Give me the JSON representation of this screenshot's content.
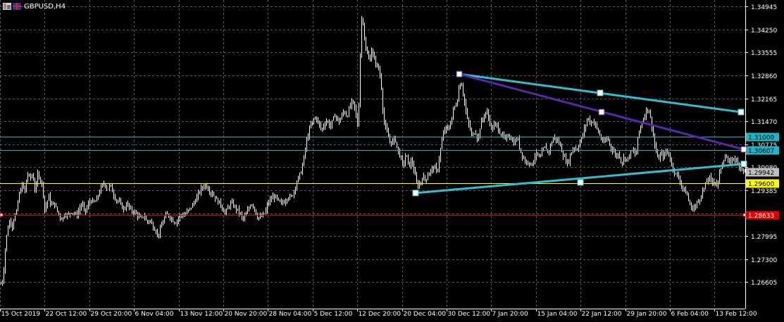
{
  "window": {
    "title": "GBPUSD,H4"
  },
  "colors": {
    "background": "#000000",
    "grid": "#5a5a5a",
    "axis_text": "#ffffff",
    "candle": "#ffffff",
    "trend_cyan": "#2fc0d0",
    "trend_purple": "#5a28a8",
    "hline_cyan": "#20b5c5",
    "hline_yellow": "#ffff00",
    "hline_red": "#e00000",
    "current_price_label": "#c0c0c0"
  },
  "chart_data": {
    "type": "candlestick",
    "symbol": "GBPUSD",
    "timeframe": "H4",
    "ylim": [
      1.258,
      1.351
    ],
    "y_ticks": [
      "1.34945",
      "1.34250",
      "1.33555",
      "1.32860",
      "1.32165",
      "1.31470",
      "1.30775",
      "1.30080",
      "1.29385",
      "1.28690",
      "1.27995",
      "1.27300",
      "1.26605"
    ],
    "x_ticks": [
      "15 Oct 2019",
      "22 Oct 12:00",
      "29 Oct 20:00",
      "6 Nov 04:00",
      "13 Nov 12:00",
      "20 Nov 20:00",
      "28 Nov 04:00",
      "5 Dec 12:00",
      "12 Dec 20:00",
      "20 Dec 04:00",
      "30 Dec 12:00",
      "7 Jan 20:00",
      "15 Jan 04:00",
      "22 Jan 12:00",
      "29 Jan 20:00",
      "6 Feb 04:00",
      "13 Feb 12:00"
    ],
    "close_path": [
      [
        0,
        1.265
      ],
      [
        4,
        1.267
      ],
      [
        7,
        1.276
      ],
      [
        10,
        1.282
      ],
      [
        14,
        1.285
      ],
      [
        17,
        1.283
      ],
      [
        20,
        1.286
      ],
      [
        23,
        1.287
      ],
      [
        26,
        1.292
      ],
      [
        29,
        1.294
      ],
      [
        32,
        1.296
      ],
      [
        35,
        1.293
      ],
      [
        38,
        1.299
      ],
      [
        42,
        1.2975
      ],
      [
        46,
        1.2985
      ],
      [
        50,
        1.293
      ],
      [
        53,
        1.299
      ],
      [
        57,
        1.297
      ],
      [
        60,
        1.295
      ],
      [
        63,
        1.288
      ],
      [
        66,
        1.29
      ],
      [
        69,
        1.292
      ],
      [
        72,
        1.289
      ],
      [
        76,
        1.29
      ],
      [
        80,
        1.288
      ],
      [
        84,
        1.286
      ],
      [
        88,
        1.285
      ],
      [
        92,
        1.287
      ],
      [
        96,
        1.286
      ],
      [
        100,
        1.2875
      ],
      [
        104,
        1.287
      ],
      [
        108,
        1.286
      ],
      [
        112,
        1.288
      ],
      [
        116,
        1.29
      ],
      [
        120,
        1.287
      ],
      [
        124,
        1.289
      ],
      [
        128,
        1.291
      ],
      [
        132,
        1.29
      ],
      [
        136,
        1.2905
      ],
      [
        140,
        1.293
      ],
      [
        144,
        1.295
      ],
      [
        148,
        1.296
      ],
      [
        152,
        1.294
      ],
      [
        156,
        1.2955
      ],
      [
        160,
        1.293
      ],
      [
        164,
        1.291
      ],
      [
        168,
        1.2905
      ],
      [
        172,
        1.289
      ],
      [
        176,
        1.288
      ],
      [
        180,
        1.29
      ],
      [
        184,
        1.288
      ],
      [
        188,
        1.2875
      ],
      [
        192,
        1.287
      ],
      [
        196,
        1.286
      ],
      [
        200,
        1.285
      ],
      [
        204,
        1.2865
      ],
      [
        208,
        1.284
      ],
      [
        212,
        1.285
      ],
      [
        216,
        1.283
      ],
      [
        220,
        1.282
      ],
      [
        224,
        1.28
      ],
      [
        228,
        1.2825
      ],
      [
        232,
        1.285
      ],
      [
        236,
        1.2865
      ],
      [
        240,
        1.286
      ],
      [
        244,
        1.285
      ],
      [
        248,
        1.284
      ],
      [
        252,
        1.285
      ],
      [
        256,
        1.2865
      ],
      [
        260,
        1.286
      ],
      [
        264,
        1.287
      ],
      [
        268,
        1.288
      ],
      [
        272,
        1.289
      ],
      [
        276,
        1.2905
      ],
      [
        280,
        1.292
      ],
      [
        284,
        1.294
      ],
      [
        288,
        1.295
      ],
      [
        292,
        1.2955
      ],
      [
        296,
        1.294
      ],
      [
        300,
        1.293
      ],
      [
        304,
        1.292
      ],
      [
        308,
        1.2905
      ],
      [
        312,
        1.29
      ],
      [
        316,
        1.288
      ],
      [
        320,
        1.287
      ],
      [
        324,
        1.289
      ],
      [
        328,
        1.29
      ],
      [
        332,
        1.289
      ],
      [
        336,
        1.288
      ],
      [
        340,
        1.287
      ],
      [
        344,
        1.285
      ],
      [
        348,
        1.286
      ],
      [
        352,
        1.288
      ],
      [
        356,
        1.29
      ],
      [
        360,
        1.289
      ],
      [
        364,
        1.286
      ],
      [
        368,
        1.2855
      ],
      [
        372,
        1.286
      ],
      [
        376,
        1.287
      ],
      [
        380,
        1.29
      ],
      [
        384,
        1.291
      ],
      [
        388,
        1.292
      ],
      [
        392,
        1.2915
      ],
      [
        396,
        1.29
      ],
      [
        400,
        1.29
      ],
      [
        404,
        1.2905
      ],
      [
        408,
        1.292
      ],
      [
        412,
        1.2915
      ],
      [
        416,
        1.293
      ],
      [
        420,
        1.296
      ],
      [
        424,
        1.298
      ],
      [
        428,
        1.3
      ],
      [
        432,
        1.305
      ],
      [
        436,
        1.31
      ],
      [
        440,
        1.313
      ],
      [
        444,
        1.315
      ],
      [
        448,
        1.316
      ],
      [
        452,
        1.314
      ],
      [
        456,
        1.312
      ],
      [
        460,
        1.314
      ],
      [
        464,
        1.315
      ],
      [
        468,
        1.313
      ],
      [
        472,
        1.315
      ],
      [
        476,
        1.317
      ],
      [
        480,
        1.314
      ],
      [
        484,
        1.316
      ],
      [
        488,
        1.318
      ],
      [
        492,
        1.316
      ],
      [
        496,
        1.319
      ],
      [
        500,
        1.321
      ],
      [
        504,
        1.318
      ],
      [
        508,
        1.312
      ],
      [
        512,
        1.343
      ],
      [
        514,
        1.348
      ],
      [
        516,
        1.342
      ],
      [
        518,
        1.338
      ],
      [
        520,
        1.334
      ],
      [
        522,
        1.336
      ],
      [
        524,
        1.332
      ],
      [
        526,
        1.335
      ],
      [
        528,
        1.338
      ],
      [
        530,
        1.332
      ],
      [
        532,
        1.334
      ],
      [
        534,
        1.331
      ],
      [
        536,
        1.332
      ],
      [
        538,
        1.329
      ],
      [
        540,
        1.328
      ],
      [
        542,
        1.322
      ],
      [
        544,
        1.315
      ],
      [
        548,
        1.312
      ],
      [
        552,
        1.309
      ],
      [
        556,
        1.308
      ],
      [
        560,
        1.31
      ],
      [
        564,
        1.306
      ],
      [
        568,
        1.304
      ],
      [
        572,
        1.301
      ],
      [
        576,
        1.305
      ],
      [
        580,
        1.301
      ],
      [
        584,
        1.303
      ],
      [
        588,
        1.299
      ],
      [
        592,
        1.295
      ],
      [
        596,
        1.296
      ],
      [
        600,
        1.298
      ],
      [
        604,
        1.297
      ],
      [
        608,
        1.299
      ],
      [
        612,
        1.3
      ],
      [
        616,
        1.301
      ],
      [
        620,
        1.299
      ],
      [
        624,
        1.305
      ],
      [
        628,
        1.31
      ],
      [
        632,
        1.313
      ],
      [
        636,
        1.312
      ],
      [
        640,
        1.315
      ],
      [
        644,
        1.319
      ],
      [
        648,
        1.32
      ],
      [
        652,
        1.326
      ],
      [
        654,
        1.327
      ],
      [
        658,
        1.322
      ],
      [
        662,
        1.316
      ],
      [
        666,
        1.313
      ],
      [
        670,
        1.31
      ],
      [
        674,
        1.312
      ],
      [
        678,
        1.309
      ],
      [
        682,
        1.314
      ],
      [
        686,
        1.316
      ],
      [
        690,
        1.318
      ],
      [
        694,
        1.315
      ],
      [
        698,
        1.312
      ],
      [
        702,
        1.314
      ],
      [
        706,
        1.313
      ],
      [
        710,
        1.311
      ],
      [
        714,
        1.31
      ],
      [
        718,
        1.309
      ],
      [
        722,
        1.311
      ],
      [
        726,
        1.309
      ],
      [
        730,
        1.308
      ],
      [
        734,
        1.31
      ],
      [
        738,
        1.306
      ],
      [
        742,
        1.304
      ],
      [
        746,
        1.302
      ],
      [
        750,
        1.303
      ],
      [
        754,
        1.301
      ],
      [
        758,
        1.304
      ],
      [
        762,
        1.305
      ],
      [
        766,
        1.303
      ],
      [
        770,
        1.306
      ],
      [
        774,
        1.307
      ],
      [
        778,
        1.305
      ],
      [
        782,
        1.308
      ],
      [
        786,
        1.31
      ],
      [
        790,
        1.309
      ],
      [
        794,
        1.308
      ],
      [
        798,
        1.305
      ],
      [
        802,
        1.303
      ],
      [
        806,
        1.302
      ],
      [
        810,
        1.305
      ],
      [
        814,
        1.307
      ],
      [
        818,
        1.306
      ],
      [
        822,
        1.308
      ],
      [
        826,
        1.31
      ],
      [
        830,
        1.313
      ],
      [
        834,
        1.316
      ],
      [
        838,
        1.314
      ],
      [
        842,
        1.315
      ],
      [
        846,
        1.313
      ],
      [
        850,
        1.311
      ],
      [
        854,
        1.309
      ],
      [
        858,
        1.308
      ],
      [
        862,
        1.31
      ],
      [
        866,
        1.307
      ],
      [
        870,
        1.306
      ],
      [
        874,
        1.304
      ],
      [
        878,
        1.305
      ],
      [
        882,
        1.302
      ],
      [
        886,
        1.304
      ],
      [
        890,
        1.303
      ],
      [
        894,
        1.305
      ],
      [
        898,
        1.306
      ],
      [
        902,
        1.304
      ],
      [
        906,
        1.311
      ],
      [
        910,
        1.314
      ],
      [
        914,
        1.316
      ],
      [
        918,
        1.319
      ],
      [
        922,
        1.317
      ],
      [
        926,
        1.312
      ],
      [
        930,
        1.306
      ],
      [
        934,
        1.303
      ],
      [
        938,
        1.305
      ],
      [
        942,
        1.304
      ],
      [
        946,
        1.306
      ],
      [
        950,
        1.304
      ],
      [
        954,
        1.301
      ],
      [
        958,
        1.299
      ],
      [
        962,
        1.298
      ],
      [
        966,
        1.296
      ],
      [
        970,
        1.294
      ],
      [
        974,
        1.293
      ],
      [
        978,
        1.29
      ],
      [
        982,
        1.288
      ],
      [
        986,
        1.289
      ],
      [
        990,
        1.29
      ],
      [
        994,
        1.292
      ],
      [
        998,
        1.294
      ],
      [
        1002,
        1.296
      ],
      [
        1006,
        1.298
      ],
      [
        1010,
        1.296
      ],
      [
        1014,
        1.297
      ],
      [
        1018,
        1.295
      ],
      [
        1022,
        1.3
      ],
      [
        1026,
        1.303
      ],
      [
        1030,
        1.304
      ],
      [
        1034,
        1.302
      ],
      [
        1038,
        1.303
      ],
      [
        1042,
        1.304
      ],
      [
        1046,
        1.302
      ],
      [
        1050,
        1.301
      ],
      [
        1054,
        1.3
      ],
      [
        1058,
        1.2994
      ]
    ],
    "horizontal_lines": [
      {
        "price": 1.31,
        "label": "1.31000",
        "color": "#20b5c5"
      },
      {
        "price": 1.30607,
        "label": "1.30607",
        "color": "#20b5c5"
      },
      {
        "price": 1.296,
        "label": "1.29600",
        "color": "#ffff00"
      },
      {
        "price": 1.28633,
        "label": "1.28633",
        "color": "#e00000"
      }
    ],
    "current_price": {
      "price": 1.29942,
      "label": "1.29942"
    },
    "trendlines": [
      {
        "color": "#2fc0d0",
        "from": [
          652,
          1.329
        ],
        "to": [
          1052,
          1.3175
        ],
        "handles": [
          [
            652,
            1.329
          ],
          [
            852,
            1.3233
          ],
          [
            1052,
            1.3175
          ]
        ]
      },
      {
        "color": "#5a28a8",
        "from": [
          652,
          1.329
        ],
        "to": [
          1056,
          1.3062
        ],
        "handles": [
          [
            652,
            1.329
          ],
          [
            854,
            1.3175
          ],
          [
            1056,
            1.3062
          ]
        ]
      },
      {
        "color": "#2fc0d0",
        "from": [
          590,
          1.293
        ],
        "to": [
          1056,
          1.3018
        ],
        "handles": [
          [
            590,
            1.293
          ],
          [
            824,
            1.2962
          ],
          [
            1056,
            1.3018
          ]
        ]
      }
    ]
  }
}
